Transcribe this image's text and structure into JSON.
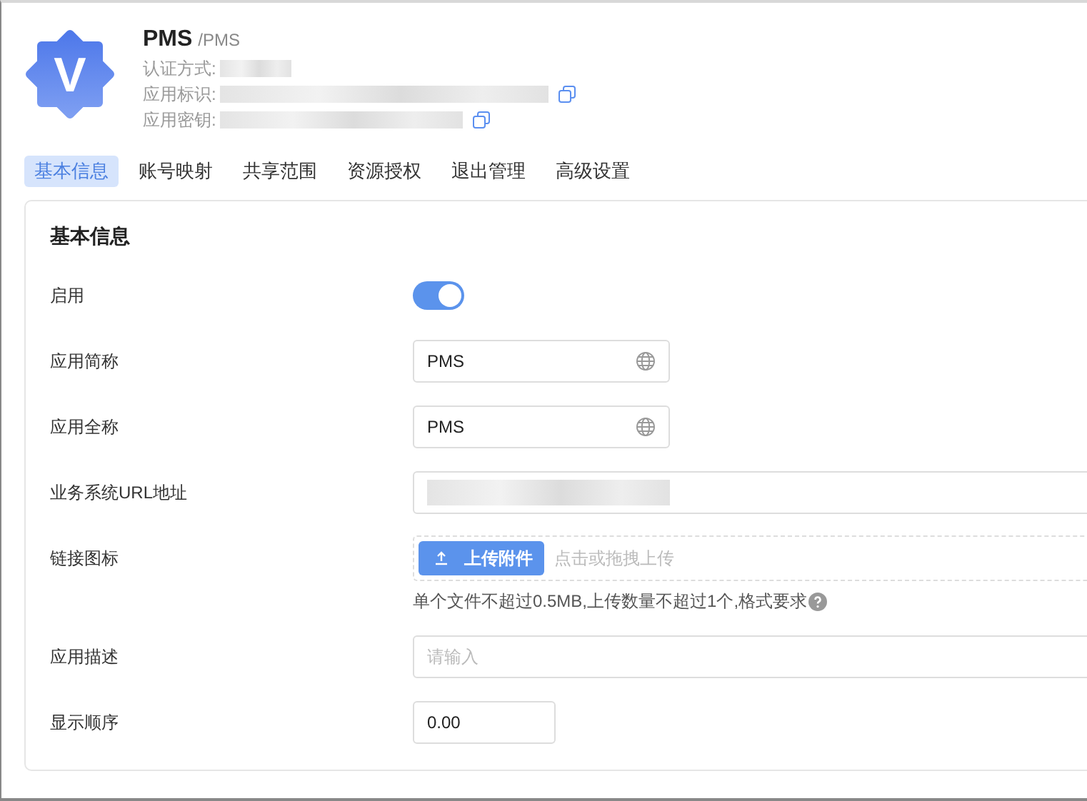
{
  "app": {
    "logo_letter": "V",
    "name": "PMS",
    "code": "/PMS",
    "info": [
      {
        "label": "认证方式:",
        "copyable": false
      },
      {
        "label": "应用标识:",
        "copyable": true
      },
      {
        "label": "应用密钥:",
        "copyable": true
      }
    ]
  },
  "tabs": [
    {
      "label": "基本信息",
      "selected": true
    },
    {
      "label": "账号映射",
      "selected": false
    },
    {
      "label": "共享范围",
      "selected": false
    },
    {
      "label": "资源授权",
      "selected": false
    },
    {
      "label": "退出管理",
      "selected": false
    },
    {
      "label": "高级设置",
      "selected": false
    }
  ],
  "form": {
    "title": "基本信息",
    "rows": [
      {
        "label": "启用",
        "kind": "switch",
        "on": true
      },
      {
        "label": "应用简称",
        "kind": "text",
        "value": "PMS"
      },
      {
        "label": "应用全称",
        "kind": "text",
        "value": "PMS"
      },
      {
        "label": "业务系统URL地址",
        "kind": "redacted"
      },
      {
        "label": "链接图标",
        "kind": "upload",
        "button": "上传附件",
        "hint": "点击或拖拽上传",
        "note": "单个文件不超过0.5MB,上传数量不超过1个,格式要求"
      },
      {
        "label": "应用描述",
        "kind": "textarea",
        "placeholder": "请输入"
      },
      {
        "label": "显示顺序",
        "kind": "number",
        "value": "0.00"
      }
    ]
  }
}
